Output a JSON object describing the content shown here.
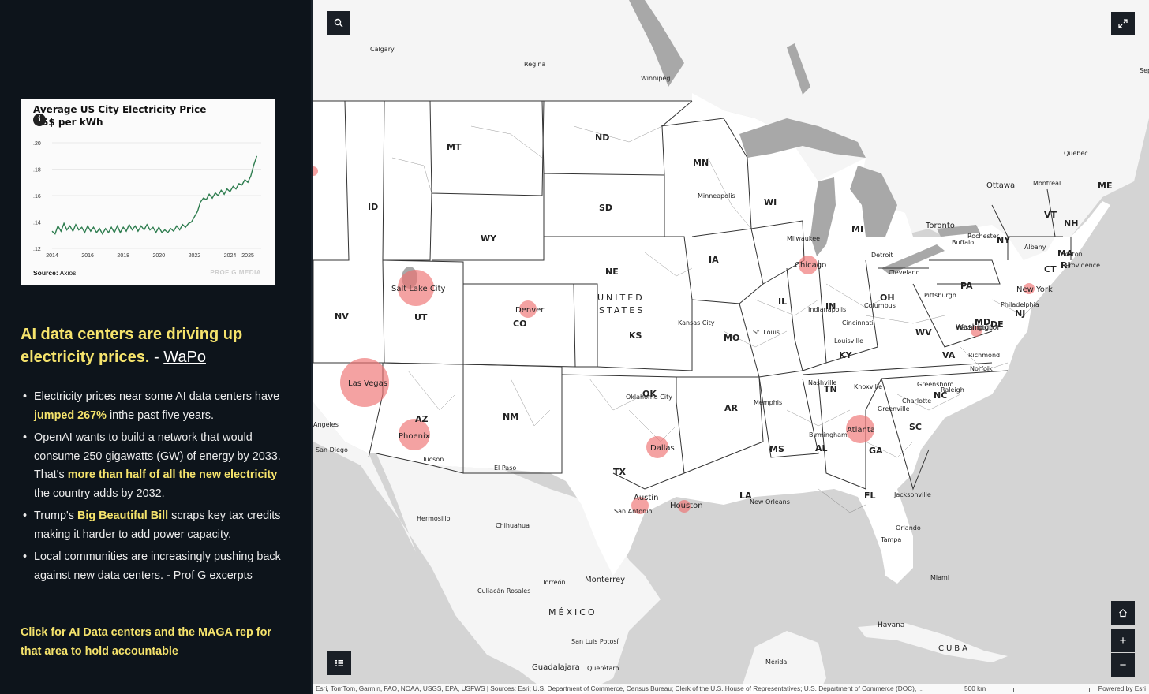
{
  "sidebar": {
    "chart": {
      "title": "Average US City Electricity Price",
      "subtitle": "US$ per kWh",
      "info_icon": "i",
      "source_label": "Source:",
      "source": "Axios",
      "watermark": "PROF G MEDIA"
    },
    "headline": {
      "text": "AI data centers are driving up electricity prices.",
      "separator": " - ",
      "link": "WaPo"
    },
    "bullets": [
      {
        "pre": "Electricity prices near some AI data centers have ",
        "highlight": "jumped 267%",
        "post": " inthe past five years."
      },
      {
        "pre": "OpenAI wants to build a network that would consume 250 gigawatts (GW) of energy by 2033. That's ",
        "highlight": "more than half of all the new electricity",
        "post": " the country adds by 2032."
      },
      {
        "pre": "Trump's ",
        "highlight": "Big Beautiful Bill",
        "post": " scraps key tax credits making it harder to add power capacity."
      },
      {
        "pre": "Local communities are increasingly pushing back against new data centers. - ",
        "link": "Prof G excerpts"
      }
    ],
    "cta": "Click for AI Data centers and the MAGA rep for that area to hold accountable"
  },
  "chart_data": {
    "type": "line",
    "title": "Average US City Electricity Price",
    "ylabel": "US$ per kWh",
    "y_ticks": [
      ".20",
      ".18",
      ".16",
      ".14",
      ".12"
    ],
    "x_ticks": [
      "2014",
      "2016",
      "2018",
      "2020",
      "2022",
      "2024",
      "2025"
    ],
    "ylim": [
      0.12,
      0.2
    ],
    "xlim": [
      2014,
      2025.75
    ],
    "grid": true,
    "color": "#2e7d4f",
    "series": [
      {
        "x": [
          2014.0,
          2014.17,
          2014.33,
          2014.5,
          2014.67,
          2014.83,
          2015.0,
          2015.17,
          2015.33,
          2015.5,
          2015.67,
          2015.83,
          2016.0,
          2016.17,
          2016.33,
          2016.5,
          2016.67,
          2016.83,
          2017.0,
          2017.17,
          2017.33,
          2017.5,
          2017.67,
          2017.83,
          2018.0,
          2018.17,
          2018.33,
          2018.5,
          2018.67,
          2018.83,
          2019.0,
          2019.17,
          2019.33,
          2019.5,
          2019.67,
          2019.83,
          2020.0,
          2020.17,
          2020.33,
          2020.5,
          2020.67,
          2020.83,
          2021.0,
          2021.17,
          2021.33,
          2021.5,
          2021.67,
          2021.83,
          2022.0,
          2022.17,
          2022.33,
          2022.5,
          2022.67,
          2022.83,
          2023.0,
          2023.17,
          2023.33,
          2023.5,
          2023.67,
          2023.83,
          2024.0,
          2024.17,
          2024.33,
          2024.5,
          2024.67,
          2024.83,
          2025.0,
          2025.17,
          2025.33,
          2025.5
        ],
        "y": [
          0.133,
          0.131,
          0.137,
          0.133,
          0.139,
          0.134,
          0.137,
          0.133,
          0.138,
          0.134,
          0.136,
          0.132,
          0.137,
          0.133,
          0.136,
          0.132,
          0.135,
          0.131,
          0.135,
          0.132,
          0.136,
          0.132,
          0.137,
          0.132,
          0.136,
          0.133,
          0.138,
          0.134,
          0.137,
          0.133,
          0.137,
          0.134,
          0.138,
          0.134,
          0.136,
          0.132,
          0.136,
          0.132,
          0.134,
          0.132,
          0.135,
          0.133,
          0.137,
          0.134,
          0.138,
          0.136,
          0.139,
          0.14,
          0.144,
          0.148,
          0.155,
          0.158,
          0.157,
          0.161,
          0.158,
          0.162,
          0.16,
          0.164,
          0.161,
          0.165,
          0.163,
          0.167,
          0.165,
          0.169,
          0.168,
          0.172,
          0.17,
          0.175,
          0.183,
          0.19
        ]
      }
    ]
  },
  "map": {
    "search_icon": "search-icon",
    "expand_icon": "expand-icon",
    "legend_icon": "list-icon",
    "home_icon": "home-icon",
    "zoom_in": "+",
    "zoom_out": "−",
    "attribution": "Esri, TomTom, Garmin, FAO, NOAA, USGS, EPA, USFWS | Sources: Esri; U.S. Department of Commerce, Census Bureau; Clerk of the U.S. House of Representatives; U.S. Department of Commerce (DOC), ...",
    "scale_label": "500 km",
    "powered_by": "Powered by Esri",
    "circles": [
      {
        "name": "Salt Lake City",
        "size": "large"
      },
      {
        "name": "Denver",
        "size": "small"
      },
      {
        "name": "Las Vegas",
        "size": "xlarge"
      },
      {
        "name": "Phoenix",
        "size": "medium"
      },
      {
        "name": "Dallas",
        "size": "small"
      },
      {
        "name": "Austin",
        "size": "small"
      },
      {
        "name": "Houston",
        "size": "small"
      },
      {
        "name": "Atlanta",
        "size": "medium"
      },
      {
        "name": "Chicago",
        "size": "small"
      },
      {
        "name": "Washington",
        "size": "small"
      },
      {
        "name": "New York",
        "size": "small"
      }
    ],
    "country_labels": [
      "UNITED",
      "STATES",
      "MÉXICO",
      "CUBA"
    ],
    "state_labels": [
      "MT",
      "ND",
      "MN",
      "SD",
      "ID",
      "WY",
      "NE",
      "IA",
      "WI",
      "MI",
      "NV",
      "UT",
      "CO",
      "KS",
      "MO",
      "IL",
      "IN",
      "OH",
      "PA",
      "NY",
      "VT",
      "NH",
      "ME",
      "MA",
      "CT",
      "RI",
      "NJ",
      "DE",
      "MD",
      "WV",
      "VA",
      "KY",
      "TN",
      "NC",
      "SC",
      "GA",
      "AL",
      "MS",
      "AR",
      "LA",
      "FL",
      "OK",
      "TX",
      "NM",
      "AZ"
    ],
    "city_labels": [
      "Calgary",
      "Regina",
      "Winnipeg",
      "Minneapolis",
      "Milwaukee",
      "Detroit",
      "Cleveland",
      "Toronto",
      "Ottawa",
      "Montreal",
      "Quebec",
      "Rochester",
      "Buffalo",
      "Albany",
      "Boston",
      "Providence",
      "Pittsburgh",
      "Philadelphia",
      "Washington",
      "Richmond",
      "Norfolk",
      "Columbus",
      "Cincinnati",
      "Indianapolis",
      "Louisville",
      "St. Louis",
      "Kansas City",
      "Nashville",
      "Knoxville",
      "Greensboro",
      "Raleigh",
      "Charlotte",
      "Greenville",
      "Memphis",
      "Birmingham",
      "New Orleans",
      "Jacksonville",
      "Orlando",
      "Tampa",
      "Miami",
      "Havana",
      "Oklahoma City",
      "El Paso",
      "San Antonio",
      "Tucson",
      "San Diego",
      "Angeles",
      "Hermosillo",
      "Chihuahua",
      "Torreón",
      "Monterrey",
      "Culiacán Rosales",
      "San Luis Potosí",
      "Guadalajara",
      "Querétaro",
      "Mérida",
      "Sep"
    ]
  }
}
